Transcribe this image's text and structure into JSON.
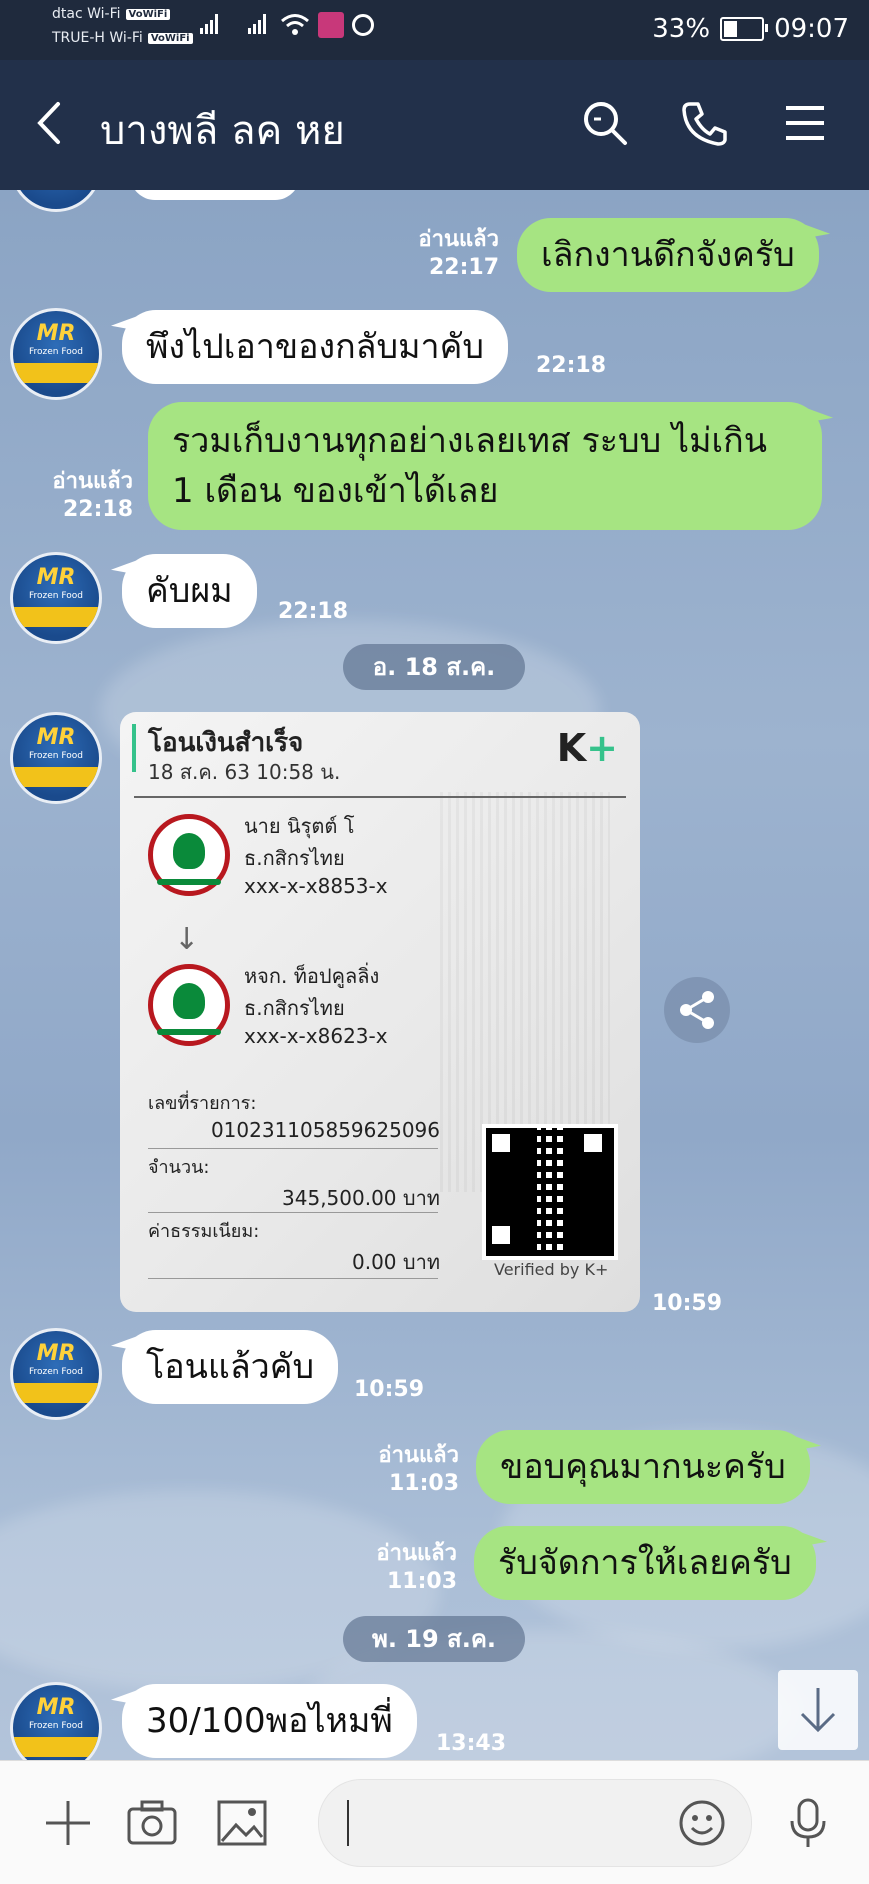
{
  "status_bar": {
    "network1": "dtac Wi-Fi",
    "network2": "TRUE-H Wi-Fi",
    "vowifi": "VoWiFi",
    "battery": "33%",
    "time": "09:07"
  },
  "header": {
    "title": "บางพลี ลค หย",
    "icons": [
      "back-icon",
      "search-icon",
      "phone-icon",
      "menu-icon"
    ]
  },
  "avatar": {
    "brand": "MR",
    "sub": "Frozen Food"
  },
  "messages": [
    {
      "dir": "out",
      "text": "เลิกงานดึกจังครับ",
      "read": "อ่านแล้ว",
      "time": "22:17"
    },
    {
      "dir": "in",
      "text": "พึงไปเอาของกลับมาคับ",
      "time": "22:18"
    },
    {
      "dir": "out",
      "text_line1": "รวมเก็บงานทุกอย่างเลยเทส ระบบ ไม่เกิน",
      "text_line2": "1 เดือน ของเข้าได้เลย",
      "read": "อ่านแล้ว",
      "time": "22:18"
    },
    {
      "dir": "in",
      "text": "คับผม",
      "time": "22:18"
    },
    {
      "dir": "in",
      "type": "image",
      "time": "10:59"
    },
    {
      "dir": "in",
      "text": "โอนแล้วคับ",
      "time": "10:59"
    },
    {
      "dir": "out",
      "text": "ขอบคุณมากนะครับ",
      "read": "อ่านแล้ว",
      "time": "11:03"
    },
    {
      "dir": "out",
      "text": "รับจัดการให้เลยครับ",
      "read": "อ่านแล้ว",
      "time": "11:03"
    },
    {
      "dir": "in",
      "text": "30/100พอไหมพี่",
      "time": "13:43"
    }
  ],
  "date_separators": [
    "อ. 18 ส.ค.",
    "พ. 19 ส.ค."
  ],
  "slip": {
    "title": "โอนเงินสำเร็จ",
    "date": "18 ส.ค. 63  10:58 น.",
    "logo": "K",
    "logo_plus": "+",
    "from_name": "นาย นิรุตต์ โ",
    "from_bank": "ธ.กสิกรไทย",
    "from_account": "xxx-x-x8853-x",
    "to_name": "หจก. ท็อปคูลลิ่ง",
    "to_bank": "ธ.กสิกรไทย",
    "to_account": "xxx-x-x8623-x",
    "ref_label": "เลขที่รายการ:",
    "ref_value": "010231105859625096",
    "amount_label": "จำนวน:",
    "amount_value": "345,500.00 บาท",
    "fee_label": "ค่าธรรมเนียม:",
    "fee_value": "0.00 บาท",
    "verified": "Verified by K+"
  },
  "input_bar": {
    "icons": [
      "plus-icon",
      "camera-icon",
      "image-icon",
      "emoji-icon",
      "mic-icon"
    ],
    "placeholder": ""
  },
  "colors": {
    "header_bg": "#22304a",
    "status_bg": "#1f2a3d",
    "bubble_out": "#a6e482",
    "bubble_in": "#ffffff",
    "kplus_green": "#35c28b",
    "kbank_red": "#b8181f"
  }
}
